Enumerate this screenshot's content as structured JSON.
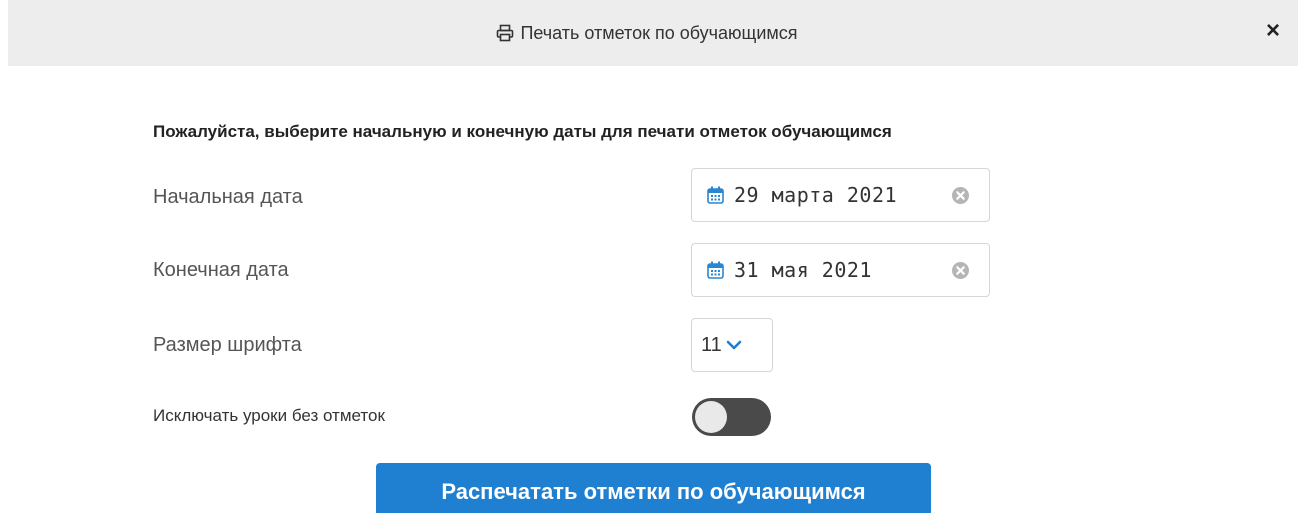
{
  "dialog": {
    "title": "Печать отметок по обучающимся",
    "close_label": "×",
    "title_icon": "printer-icon"
  },
  "form": {
    "instruction": "Пожалуйста, выберите начальную и конечную даты для печати отметок обучающимся",
    "start_date": {
      "label": "Начальная дата",
      "value": "29 марта 2021"
    },
    "end_date": {
      "label": "Конечная дата",
      "value": "31 мая 2021"
    },
    "font_size": {
      "label": "Размер шрифта",
      "value": "11"
    },
    "exclude_lessons": {
      "label": "Исключать уроки без отметок",
      "enabled": false
    },
    "print_button_label": "Распечатать отметки по обучающимся"
  },
  "colors": {
    "header_bg": "#ededed",
    "accent": "#1f7fd0",
    "toggle_off": "#4a4a4a"
  }
}
